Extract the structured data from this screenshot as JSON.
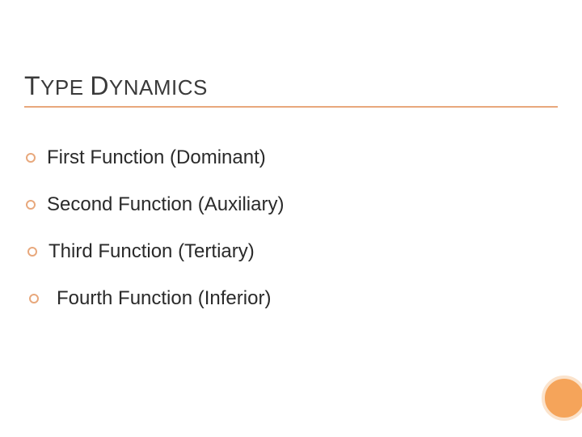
{
  "title": {
    "word1_cap": "T",
    "word1_rest": "YPE",
    "word2_cap": "D",
    "word2_rest": "YNAMICS"
  },
  "bullets": [
    {
      "text": "First Function (Dominant)"
    },
    {
      "text": "Second Function (Auxiliary)"
    },
    {
      "text": "Third Function (Tertiary)"
    },
    {
      "text": "Fourth Function (Inferior)"
    }
  ],
  "colors": {
    "accent": "#e8a87c",
    "circle_fill": "#f5a45a",
    "circle_ring": "#fbe3cc"
  }
}
